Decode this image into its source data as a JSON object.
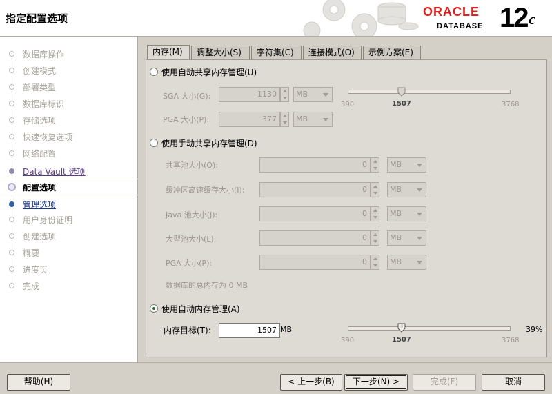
{
  "header": {
    "title": "指定配置选项",
    "brand": "ORACLE",
    "product": "DATABASE",
    "version_main": "12",
    "version_suffix": "c"
  },
  "steps": [
    {
      "label": "数据库操作",
      "state": "pending"
    },
    {
      "label": "创建模式",
      "state": "pending"
    },
    {
      "label": "部署类型",
      "state": "pending"
    },
    {
      "label": "数据库标识",
      "state": "pending"
    },
    {
      "label": "存储选项",
      "state": "pending"
    },
    {
      "label": "快速恢复选项",
      "state": "pending"
    },
    {
      "label": "网络配置",
      "state": "pending"
    },
    {
      "label": "Data Vault 选项",
      "state": "done"
    },
    {
      "label": "配置选项",
      "state": "current"
    },
    {
      "label": "管理选项",
      "state": "next"
    },
    {
      "label": "用户身份证明",
      "state": "pending"
    },
    {
      "label": "创建选项",
      "state": "pending"
    },
    {
      "label": "概要",
      "state": "pending"
    },
    {
      "label": "进度页",
      "state": "pending"
    },
    {
      "label": "完成",
      "state": "pending"
    }
  ],
  "tabs": [
    {
      "label": "内存(M)",
      "active": true
    },
    {
      "label": "调整大小(S)",
      "active": false
    },
    {
      "label": "字符集(C)",
      "active": false
    },
    {
      "label": "连接模式(O)",
      "active": false
    },
    {
      "label": "示例方案(E)",
      "active": false
    }
  ],
  "auto_shared": {
    "label": "使用自动共享内存管理(U)",
    "sga_label": "SGA 大小(G):",
    "sga_value": "1130",
    "sga_unit": "MB",
    "pga_label": "PGA 大小(P):",
    "pga_value": "377",
    "pga_unit": "MB",
    "slider_min": "390",
    "slider_current": "1507",
    "slider_max": "3768"
  },
  "manual_shared": {
    "label": "使用手动共享内存管理(D)",
    "rows": [
      {
        "label": "共享池大小(O):",
        "value": "0",
        "unit": "MB"
      },
      {
        "label": "缓冲区高速缓存大小(I):",
        "value": "0",
        "unit": "MB"
      },
      {
        "label": "Java 池大小(J):",
        "value": "0",
        "unit": "MB"
      },
      {
        "label": "大型池大小(L):",
        "value": "0",
        "unit": "MB"
      },
      {
        "label": "PGA 大小(P):",
        "value": "0",
        "unit": "MB"
      }
    ],
    "total": "数据库的总内存为 0 MB"
  },
  "auto_memory": {
    "label": "使用自动内存管理(A)",
    "target_label": "内存目标(T):",
    "target_value": "1507",
    "target_unit": "MB",
    "slider_min": "390",
    "slider_current": "1507",
    "slider_max": "3768",
    "slider_percent": "39%"
  },
  "buttons": {
    "help": "帮助(H)",
    "back": "< 上一步(B)",
    "next": "下一步(N) >",
    "finish": "完成(F)",
    "cancel": "取消"
  }
}
